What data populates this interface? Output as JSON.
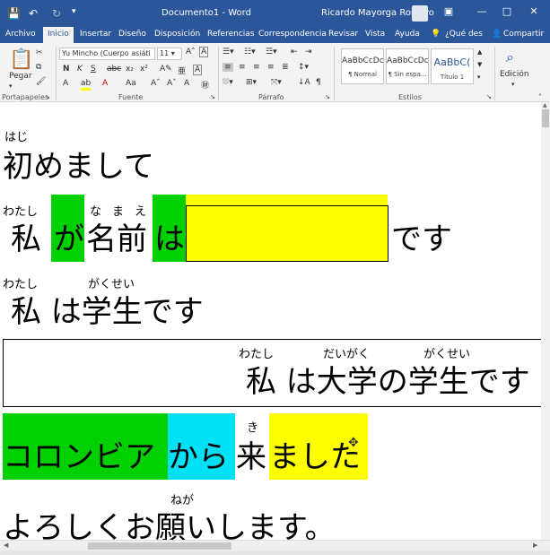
{
  "titlebar": {
    "doc_title": "Documento1 - Word",
    "user": "Ricardo Mayorga Romero",
    "minimize": "—",
    "restore": "□",
    "close": "✕",
    "ribbon_display": "▣"
  },
  "tabs": [
    "Archivo",
    "Inicio",
    "Insertar",
    "Diseño",
    "Disposición",
    "Referencias",
    "Correspondencia",
    "Revisar",
    "Vista",
    "Ayuda"
  ],
  "tell_me": "¿Qué des",
  "share": "Compartir",
  "ribbon": {
    "paste_label": "Pegar",
    "font_name": "Yu Mincho (Cuerpo asiáti",
    "font_size": "11",
    "groups": {
      "clipboard": "Portapapeles",
      "font": "Fuente",
      "paragraph": "Párrafo",
      "styles": "Estilos",
      "editing": "Edición"
    },
    "styles": [
      {
        "preview": "AaBbCcDc",
        "name": "¶ Normal"
      },
      {
        "preview": "AaBbCcDc",
        "name": "¶ Sin espa..."
      },
      {
        "preview": "AaBbC(",
        "name": "Título 1"
      }
    ]
  },
  "document": {
    "line1": {
      "furigana": "はじ",
      "text": "初めまして"
    },
    "line2": {
      "furigana_watashi": "わたし",
      "furigana_namae": "なまえ",
      "watashi": "私",
      "ga": "が",
      "namae": "名前",
      "wa": "は",
      "desu": "です"
    },
    "line3": {
      "furigana_watashi": "わたし",
      "furigana_gakusei": "がくせい",
      "text": "私 は学生です"
    },
    "line4": {
      "furigana_watashi": "わたし",
      "furigana_daigaku": "だいがく",
      "furigana_gakusei": "がくせい",
      "text": "私 は大学の学生です"
    },
    "line5": {
      "colombia": "コロンビア",
      "kara": "から",
      "furigana_ki": "き",
      "ki": "来",
      "mashita": "ました"
    },
    "line6": {
      "furigana_negai": "ねが",
      "text": "よろしくお願いします。"
    }
  },
  "colors": {
    "word_blue": "#2b579a",
    "green_highlight": "#00d000",
    "yellow_highlight": "#ffff00",
    "cyan_highlight": "#00e1f5"
  }
}
